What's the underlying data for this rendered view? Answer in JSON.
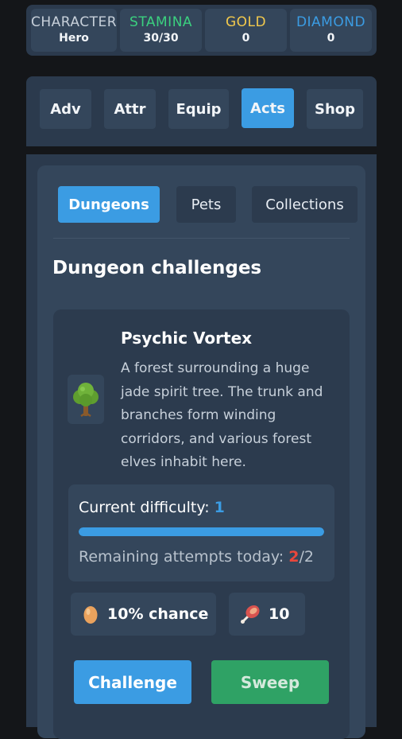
{
  "stats": [
    {
      "label": "CHARACTER",
      "value": "Hero",
      "color": "#c7d0da"
    },
    {
      "label": "STAMINA",
      "value": "30/30",
      "color": "#3bd07f"
    },
    {
      "label": "GOLD",
      "value": "0",
      "color": "#f2c94c"
    },
    {
      "label": "DIAMOND",
      "value": "0",
      "color": "#3b9ce3"
    }
  ],
  "nav": {
    "tabs": [
      "Adv",
      "Attr",
      "Equip",
      "Acts",
      "Shop"
    ],
    "active": "Acts"
  },
  "sub_tabs": [
    "Dungeons",
    "Pets",
    "Collections"
  ],
  "section_title": "Dungeon challenges",
  "dungeon": {
    "icon": "tree-icon",
    "name": "Psychic Vortex",
    "description": "A forest surrounding a huge jade spirit tree. The trunk and branches form winding corridors, and various forest elves inhabit here.",
    "difficulty_label": "Current difficulty: ",
    "difficulty_value": "1",
    "difficulty_progress": 1.0,
    "attempts_label": "Remaining attempts today: ",
    "attempts_left": "2",
    "attempts_total": "/2",
    "rewards": [
      {
        "icon": "egg-icon",
        "text": "10% chance"
      },
      {
        "icon": "meat-icon",
        "text": "10"
      }
    ],
    "challenge_label": "Challenge",
    "sweep_label": "Sweep"
  },
  "colors": {
    "accent": "#3b9ce3",
    "sweep": "#2fa265",
    "warning": "#e9473c"
  }
}
